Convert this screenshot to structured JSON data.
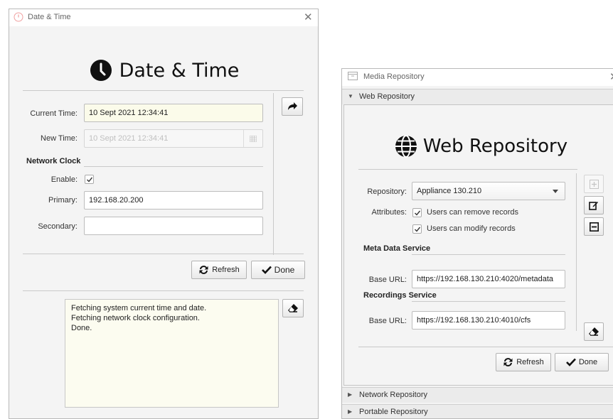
{
  "date_window": {
    "title": "Date & Time",
    "header": "Date & Time",
    "current_time_label": "Current Time:",
    "current_time_value": "10 Sept 2021 12:34:41",
    "new_time_label": "New Time:",
    "new_time_value": "10 Sept 2021 12:34:41",
    "network_clock_section": "Network Clock",
    "enable_label": "Enable:",
    "enable_checked": true,
    "primary_label": "Primary:",
    "primary_value": "192.168.20.200",
    "secondary_label": "Secondary:",
    "secondary_value": "",
    "refresh_label": "Refresh",
    "done_label": "Done",
    "log_lines": [
      "Fetching system current time and date.",
      "Fetching network clock configuration.",
      "Done."
    ]
  },
  "media_window": {
    "title": "Media Repository",
    "accordions": [
      {
        "label": "Web Repository",
        "expanded": true
      },
      {
        "label": "Network Repository",
        "expanded": false
      },
      {
        "label": "Portable Repository",
        "expanded": false
      }
    ],
    "header": "Web Repository",
    "repository_label": "Repository:",
    "repository_value": "Appliance 130.210",
    "attributes_label": "Attributes:",
    "attr_remove_label": "Users can remove records",
    "attr_remove_checked": true,
    "attr_modify_label": "Users can modify records",
    "attr_modify_checked": true,
    "meta_section": "Meta Data Service",
    "meta_base_url_label": "Base URL:",
    "meta_base_url_value": "https://192.168.130.210:4020/metadata",
    "rec_section": "Recordings Service",
    "rec_base_url_label": "Base URL:",
    "rec_base_url_value": "https://192.168.130.210:4010/cfs",
    "refresh_label": "Refresh",
    "done_label": "Done"
  },
  "colors": {
    "accent_text": "#111111",
    "log_background": "#fcfcf0",
    "focus_field": "#fbfbea"
  }
}
